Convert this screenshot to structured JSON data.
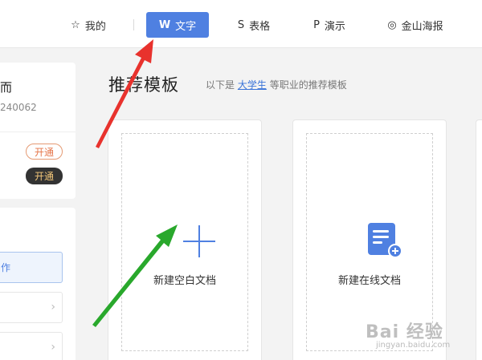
{
  "nav": {
    "items": [
      {
        "label": "我的",
        "icon": "star-icon"
      },
      {
        "label": "文字",
        "icon": "w-writer-icon",
        "active": true
      },
      {
        "label": "表格",
        "icon": "s-sheet-icon"
      },
      {
        "label": "演示",
        "icon": "p-slides-icon"
      },
      {
        "label": "金山海报",
        "icon": "poster-icon"
      }
    ],
    "accent": "#4f80e1"
  },
  "sidebar": {
    "user_name_fragment": "而",
    "user_id_fragment": "240062",
    "open_outline": "开通",
    "open_dark": "开通",
    "selected_fragment": "作"
  },
  "main": {
    "heading": "推荐模板",
    "sub_prefix": "以下是",
    "sub_link": "大学生",
    "sub_suffix": "等职业的推荐模板",
    "cards": [
      {
        "label": "新建空白文档",
        "icon": "plus-icon"
      },
      {
        "label": "新建在线文档",
        "icon": "online-doc-icon"
      }
    ]
  },
  "watermark": {
    "text": "Bai 经验",
    "url": "jingyan.baidu.com"
  }
}
